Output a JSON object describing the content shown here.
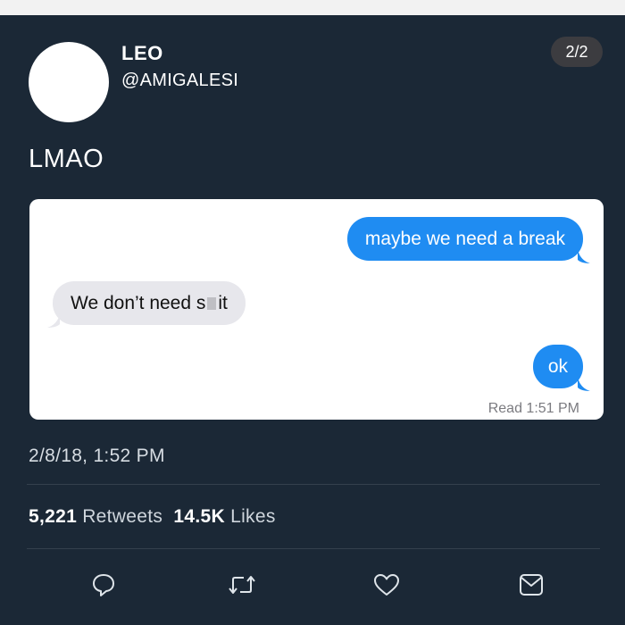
{
  "tweet": {
    "display_name": "LEO",
    "handle": "@AMIGALESI",
    "counter": "2/2",
    "text": "LMAO",
    "timestamp": "2/8/18, 1:52 PM",
    "retweets_count": "5,221",
    "retweets_label": "Retweets",
    "likes_count": "14.5K",
    "likes_label": "Likes"
  },
  "conversation": {
    "messages": [
      {
        "from": "me",
        "text": "maybe we need a break"
      },
      {
        "from": "them",
        "text_before": "We don’t need s",
        "text_after": "it"
      },
      {
        "from": "me",
        "text": "ok"
      }
    ],
    "read_receipt": "Read 1:51 PM"
  },
  "actions": {
    "icons": [
      "reply-icon",
      "retweet-icon",
      "like-icon",
      "share-icon"
    ]
  },
  "colors": {
    "background": "#1b2836",
    "sent_bubble": "#1f8cf2",
    "received_bubble": "#e7e7ec"
  }
}
